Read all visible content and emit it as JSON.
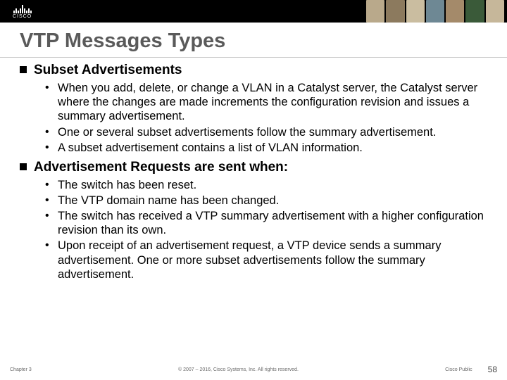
{
  "header": {
    "logo_text": "CISCO"
  },
  "title": "VTP Messages Types",
  "sections": [
    {
      "heading": "Subset Advertisements",
      "items": [
        "When you add, delete, or change a VLAN in a Catalyst server, the Catalyst server where the changes are made increments the configuration revision and issues a summary advertisement.",
        "One or several subset advertisements follow the summary advertisement.",
        "A subset advertisement contains a list of VLAN information."
      ]
    },
    {
      "heading": "Advertisement Requests are sent when:",
      "items": [
        "The switch has been reset.",
        "The VTP domain name has been changed.",
        "The switch has received a VTP summary advertisement with a higher configuration revision than its own.",
        "Upon receipt of an advertisement request, a VTP device sends a summary advertisement. One or more subset advertisements follow the summary advertisement."
      ]
    }
  ],
  "footer": {
    "chapter": "Chapter 3",
    "copyright": "© 2007 – 2016, Cisco Systems, Inc. All rights reserved.",
    "public": "Cisco Public",
    "page": "58"
  }
}
